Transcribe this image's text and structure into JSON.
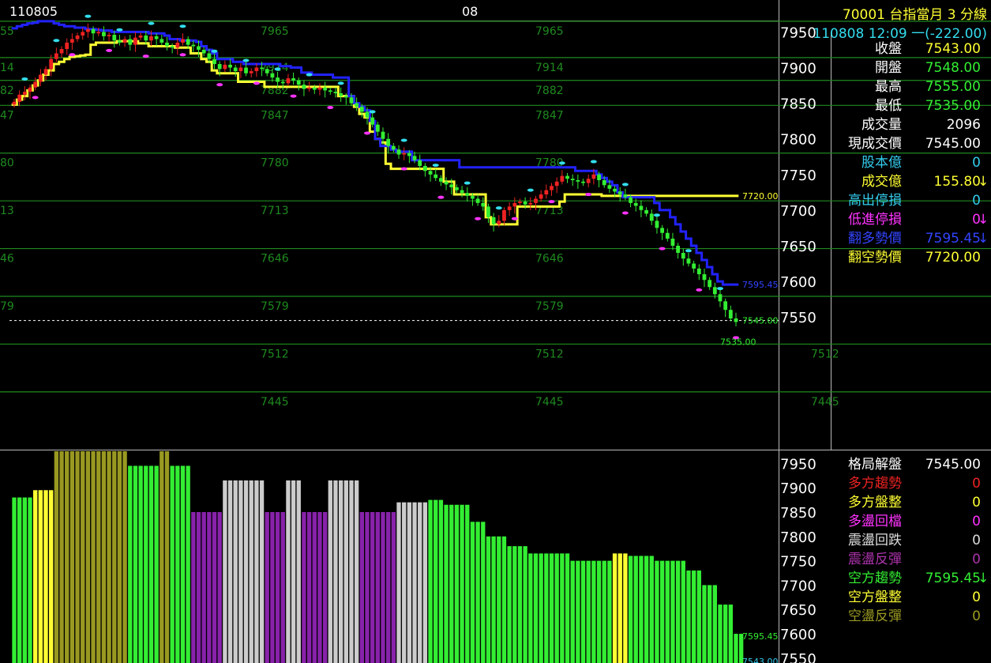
{
  "header": {
    "title": "70001  台指當月 3 分線",
    "datetime": "110808 12:09 一(-222.00)",
    "date_left": "110805",
    "date_mid": "08"
  },
  "quote": [
    {
      "label": "收盤",
      "value": "7543.00",
      "lcolor": "#ffffff",
      "vcolor": "#ffff33"
    },
    {
      "label": "開盤",
      "value": "7548.00",
      "lcolor": "#ffffff",
      "vcolor": "#33ee33"
    },
    {
      "label": "最高",
      "value": "7555.00",
      "lcolor": "#ffffff",
      "vcolor": "#33ee33"
    },
    {
      "label": "最低",
      "value": "7535.00",
      "lcolor": "#ffffff",
      "vcolor": "#33ee33"
    },
    {
      "label": "成交量",
      "value": "2096",
      "lcolor": "#ffffff",
      "vcolor": "#ffffff"
    },
    {
      "label": "現成交價",
      "value": "7545.00",
      "lcolor": "#ffffff",
      "vcolor": "#ffffff"
    },
    {
      "label": "股本億",
      "value": "0",
      "lcolor": "#33ccee",
      "vcolor": "#33ccee"
    },
    {
      "label": "成交億",
      "value": "155.80",
      "lcolor": "#ffff33",
      "vcolor": "#ffff33",
      "arrow": "↓",
      "acolor": "#ffff33"
    },
    {
      "label": "高出停損",
      "value": "0",
      "lcolor": "#33ccee",
      "vcolor": "#33ccee"
    },
    {
      "label": "低進停損",
      "value": "0",
      "lcolor": "#ff33ff",
      "vcolor": "#ff33ff",
      "arrow": "↓",
      "acolor": "#ff33ff"
    },
    {
      "label": "翻多勢價",
      "value": "7595.45",
      "lcolor": "#3344ff",
      "vcolor": "#3344ff",
      "arrow": "↓",
      "acolor": "#3344ff"
    },
    {
      "label": "翻空勢價",
      "value": "7720.00",
      "lcolor": "#ffff33",
      "vcolor": "#ffff33"
    }
  ],
  "pattern": [
    {
      "label": "格局解盤",
      "value": "7545.00",
      "lcolor": "#ffffff",
      "vcolor": "#ffffff"
    },
    {
      "label": "多方趨勢",
      "value": "0",
      "lcolor": "#ee2222",
      "vcolor": "#ee2222"
    },
    {
      "label": "多方盤整",
      "value": "0",
      "lcolor": "#ffff33",
      "vcolor": "#ffff33"
    },
    {
      "label": "多盪回檔",
      "value": "0",
      "lcolor": "#ff33ff",
      "vcolor": "#ff33ff"
    },
    {
      "label": "震盪回跌",
      "value": "0",
      "lcolor": "#dddddd",
      "vcolor": "#dddddd"
    },
    {
      "label": "震盪反彈",
      "value": "0",
      "lcolor": "#aa33aa",
      "vcolor": "#aa33aa"
    },
    {
      "label": "空方趨勢",
      "value": "7595.45",
      "lcolor": "#33ee33",
      "vcolor": "#33ee33",
      "arrow": "↓",
      "acolor": "#33ee33"
    },
    {
      "label": "空方盤整",
      "value": "0",
      "lcolor": "#ffff33",
      "vcolor": "#ffff33"
    },
    {
      "label": "空盪反彈",
      "value": "0",
      "lcolor": "#999922",
      "vcolor": "#999922"
    }
  ],
  "chart_data": {
    "type": "candlestick",
    "main": {
      "ylim": [
        7365,
        7966
      ],
      "yticks": [
        "7950",
        "7900",
        "7850",
        "7800",
        "7750",
        "7700",
        "7650",
        "7600",
        "7550"
      ],
      "gridlines": [
        {
          "value": 7965,
          "label": "7965"
        },
        {
          "value": 7914,
          "label": "7914"
        },
        {
          "value": 7882,
          "label": "7882"
        },
        {
          "value": 7847,
          "label": "7847"
        },
        {
          "value": 7780,
          "label": "7780"
        },
        {
          "value": 7713,
          "label": "7713"
        },
        {
          "value": 7646,
          "label": "7646"
        },
        {
          "value": 7579,
          "label": "7579"
        },
        {
          "value": 7512,
          "label": "7512"
        },
        {
          "value": 7445,
          "label": "7445"
        }
      ],
      "left_labels": [
        "55",
        "14",
        "82",
        "47",
        "80",
        "13",
        "46",
        "79"
      ],
      "close_line": 7545,
      "annotations": [
        {
          "text": "7720.00",
          "value": 7720,
          "color": "#ffff33"
        },
        {
          "text": "7595.45",
          "value": 7595.45,
          "color": "#3344ff"
        },
        {
          "text": "7545.00",
          "value": 7545,
          "color": "#33ee33"
        },
        {
          "text": "7535.00",
          "value": 7535,
          "color": "#33ee33",
          "below": true
        }
      ]
    },
    "sub": {
      "ylim": [
        7540,
        7975
      ],
      "yticks": [
        "7950",
        "7900",
        "7850",
        "7800",
        "7750",
        "7700",
        "7650",
        "7600",
        "7550"
      ],
      "annotations": [
        {
          "text": "7595.45",
          "value": 7595.45,
          "color": "#33ee33"
        },
        {
          "text": "7543.00",
          "value": 7543,
          "color": "#33ccee"
        }
      ]
    },
    "close": [
      7852,
      7862,
      7866,
      7872,
      7880,
      7890,
      7898,
      7912,
      7920,
      7926,
      7935,
      7940,
      7945,
      7950,
      7954,
      7948,
      7950,
      7944,
      7946,
      7938,
      7935,
      7940,
      7932,
      7942,
      7945,
      7938,
      7944,
      7940,
      7935,
      7930,
      7928,
      7935,
      7940,
      7932,
      7930,
      7925,
      7920,
      7912,
      7905,
      7898,
      7904,
      7900,
      7895,
      7900,
      7892,
      7895,
      7900,
      7898,
      7892,
      7886,
      7880,
      7878,
      7885,
      7882,
      7876,
      7870,
      7872,
      7869,
      7872,
      7868,
      7866,
      7864,
      7860,
      7858,
      7850,
      7845,
      7838,
      7830,
      7820,
      7810,
      7800,
      7790,
      7785,
      7778,
      7780,
      7776,
      7770,
      7762,
      7755,
      7750,
      7745,
      7740,
      7736,
      7732,
      7728,
      7724,
      7720,
      7716,
      7710,
      7705,
      7690,
      7680,
      7685,
      7700,
      7705,
      7710,
      7712,
      7708,
      7710,
      7716,
      7722,
      7728,
      7734,
      7740,
      7748,
      7744,
      7742,
      7740,
      7738,
      7744,
      7750,
      7742,
      7735,
      7730,
      7726,
      7722,
      7718,
      7710,
      7706,
      7700,
      7695,
      7685,
      7675,
      7668,
      7660,
      7650,
      7640,
      7632,
      7625,
      7618,
      7610,
      7602,
      7592,
      7582,
      7572,
      7560,
      7548,
      7543
    ],
    "long_stop": [
      7848,
      7855,
      7860,
      7868,
      7875,
      7882,
      7890,
      7896,
      7905,
      7908,
      7912,
      7915,
      7916,
      7917,
      7918,
      7932,
      7935,
      7935,
      7935,
      7935,
      7937,
      7937,
      7937,
      7937,
      7934,
      7934,
      7930,
      7930,
      7930,
      7930,
      7930,
      7928,
      7928,
      7928,
      7920,
      7920,
      7912,
      7908,
      7896,
      7892,
      7892,
      7892,
      7892,
      7880,
      7880,
      7880,
      7880,
      7880,
      7873,
      7873,
      7873,
      7873,
      7873,
      7873,
      7873,
      7873,
      7873,
      7873,
      7873,
      7873,
      7873,
      7873,
      7860,
      7860,
      7860,
      7845,
      7835,
      7830,
      7810,
      7800,
      7795,
      7765,
      7758,
      7758,
      7758,
      7758,
      7758,
      7758,
      7758,
      7758,
      7758,
      7758,
      7740,
      7740,
      7722,
      7722,
      7722,
      7722,
      7722,
      7722,
      7690,
      7680,
      7680,
      7680,
      7680,
      7680,
      7705,
      7705,
      7705,
      7705,
      7705,
      7705,
      7705,
      7705,
      7712,
      7722,
      7722,
      7722,
      7722,
      7722,
      7722,
      7722,
      7720,
      7720,
      7720,
      7720,
      7720,
      7720,
      7720,
      7720,
      7720,
      7720,
      7720,
      7720,
      7720,
      7720,
      7720,
      7720,
      7720,
      7720,
      7720,
      7720,
      7720,
      7720,
      7720,
      7720,
      7720,
      7720
    ],
    "short_stop": [
      7955,
      7958,
      7960,
      7962,
      7963,
      7965,
      7965,
      7965,
      7962,
      7960,
      7958,
      7958,
      7956,
      7956,
      7954,
      7954,
      7953,
      7952,
      7952,
      7950,
      7950,
      7950,
      7950,
      7950,
      7950,
      7950,
      7948,
      7948,
      7948,
      7945,
      7940,
      7940,
      7938,
      7938,
      7938,
      7936,
      7930,
      7925,
      7920,
      7912,
      7912,
      7912,
      7908,
      7908,
      7905,
      7905,
      7905,
      7905,
      7905,
      7905,
      7905,
      7902,
      7902,
      7900,
      7900,
      7893,
      7893,
      7890,
      7890,
      7890,
      7890,
      7886,
      7886,
      7886,
      7860,
      7850,
      7845,
      7840,
      7825,
      7800,
      7790,
      7790,
      7785,
      7782,
      7782,
      7782,
      7770,
      7770,
      7770,
      7770,
      7770,
      7770,
      7770,
      7770,
      7770,
      7760,
      7760,
      7760,
      7760,
      7760,
      7760,
      7760,
      7760,
      7760,
      7760,
      7760,
      7760,
      7760,
      7760,
      7760,
      7760,
      7760,
      7760,
      7760,
      7760,
      7760,
      7760,
      7755,
      7755,
      7755,
      7755,
      7750,
      7745,
      7740,
      7735,
      7725,
      7718,
      7718,
      7718,
      7718,
      7718,
      7718,
      7710,
      7700,
      7700,
      7690,
      7680,
      7670,
      7660,
      7650,
      7640,
      7630,
      7620,
      7610,
      7600,
      7595.45,
      7595.45,
      7595.45
    ],
    "regime": [
      {
        "start": 0,
        "end": 4,
        "color": "#33ee33",
        "level": 7880
      },
      {
        "start": 4,
        "end": 8,
        "color": "#ffff33",
        "level": 7895
      },
      {
        "start": 8,
        "end": 22,
        "color": "#999922",
        "level": 7975
      },
      {
        "start": 22,
        "end": 28,
        "color": "#33ee33",
        "level": 7945
      },
      {
        "start": 28,
        "end": 30,
        "color": "#999922",
        "level": 7975
      },
      {
        "start": 30,
        "end": 34,
        "color": "#33ee33",
        "level": 7945
      },
      {
        "start": 34,
        "end": 40,
        "color": "#8822aa",
        "level": 7850
      },
      {
        "start": 40,
        "end": 48,
        "color": "#cccccc",
        "level": 7915
      },
      {
        "start": 48,
        "end": 52,
        "color": "#8822aa",
        "level": 7850
      },
      {
        "start": 52,
        "end": 55,
        "color": "#cccccc",
        "level": 7915
      },
      {
        "start": 55,
        "end": 60,
        "color": "#8822aa",
        "level": 7850
      },
      {
        "start": 60,
        "end": 66,
        "color": "#cccccc",
        "level": 7915
      },
      {
        "start": 66,
        "end": 73,
        "color": "#8822aa",
        "level": 7850
      },
      {
        "start": 73,
        "end": 79,
        "color": "#cccccc",
        "level": 7870
      },
      {
        "start": 79,
        "end": 82,
        "color": "#33ee33",
        "level": 7875
      },
      {
        "start": 82,
        "end": 87,
        "color": "#33ee33",
        "level": 7865
      },
      {
        "start": 87,
        "end": 90,
        "color": "#33ee33",
        "level": 7830
      },
      {
        "start": 90,
        "end": 94,
        "color": "#33ee33",
        "level": 7800
      },
      {
        "start": 94,
        "end": 98,
        "color": "#33ee33",
        "level": 7780
      },
      {
        "start": 98,
        "end": 106,
        "color": "#33ee33",
        "level": 7765
      },
      {
        "start": 106,
        "end": 114,
        "color": "#33ee33",
        "level": 7750
      },
      {
        "start": 114,
        "end": 117,
        "color": "#ffff33",
        "level": 7765
      },
      {
        "start": 117,
        "end": 122,
        "color": "#33ee33",
        "level": 7760
      },
      {
        "start": 122,
        "end": 128,
        "color": "#33ee33",
        "level": 7750
      },
      {
        "start": 128,
        "end": 131,
        "color": "#33ee33",
        "level": 7730
      },
      {
        "start": 131,
        "end": 134,
        "color": "#33ee33",
        "level": 7700
      },
      {
        "start": 134,
        "end": 137,
        "color": "#33ee33",
        "level": 7660
      },
      {
        "start": 137,
        "end": 139,
        "color": "#33ee33",
        "level": 7600
      }
    ]
  }
}
